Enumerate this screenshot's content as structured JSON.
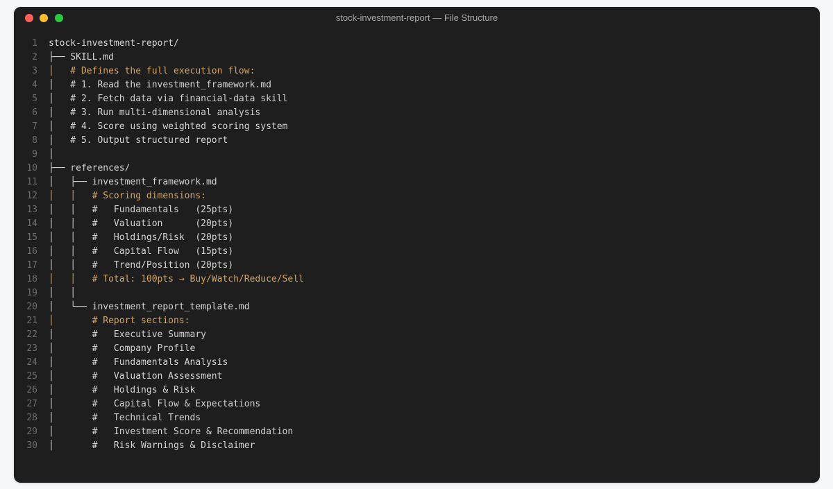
{
  "window": {
    "title": "stock-investment-report — File Structure"
  },
  "lines": [
    {
      "n": "1",
      "text": "stock-investment-report/",
      "hl": false
    },
    {
      "n": "2",
      "text": "├── SKILL.md",
      "hl": false
    },
    {
      "n": "3",
      "text": "│   # Defines the full execution flow:",
      "hl": true
    },
    {
      "n": "4",
      "text": "│   # 1. Read the investment_framework.md",
      "hl": false
    },
    {
      "n": "5",
      "text": "│   # 2. Fetch data via financial-data skill",
      "hl": false
    },
    {
      "n": "6",
      "text": "│   # 3. Run multi-dimensional analysis",
      "hl": false
    },
    {
      "n": "7",
      "text": "│   # 4. Score using weighted scoring system",
      "hl": false
    },
    {
      "n": "8",
      "text": "│   # 5. Output structured report",
      "hl": false
    },
    {
      "n": "9",
      "text": "│",
      "hl": false
    },
    {
      "n": "10",
      "text": "├── references/",
      "hl": false
    },
    {
      "n": "11",
      "text": "│   ├── investment_framework.md",
      "hl": false
    },
    {
      "n": "12",
      "text": "│   │   # Scoring dimensions:",
      "hl": true
    },
    {
      "n": "13",
      "text": "│   │   #   Fundamentals   (25pts)",
      "hl": false
    },
    {
      "n": "14",
      "text": "│   │   #   Valuation      (20pts)",
      "hl": false
    },
    {
      "n": "15",
      "text": "│   │   #   Holdings/Risk  (20pts)",
      "hl": false
    },
    {
      "n": "16",
      "text": "│   │   #   Capital Flow   (15pts)",
      "hl": false
    },
    {
      "n": "17",
      "text": "│   │   #   Trend/Position (20pts)",
      "hl": false
    },
    {
      "n": "18",
      "text": "│   │   # Total: 100pts → Buy/Watch/Reduce/Sell",
      "hl": true
    },
    {
      "n": "19",
      "text": "│   │",
      "hl": false
    },
    {
      "n": "20",
      "text": "│   └── investment_report_template.md",
      "hl": false
    },
    {
      "n": "21",
      "text": "│       # Report sections:",
      "hl": true
    },
    {
      "n": "22",
      "text": "│       #   Executive Summary",
      "hl": false
    },
    {
      "n": "23",
      "text": "│       #   Company Profile",
      "hl": false
    },
    {
      "n": "24",
      "text": "│       #   Fundamentals Analysis",
      "hl": false
    },
    {
      "n": "25",
      "text": "│       #   Valuation Assessment",
      "hl": false
    },
    {
      "n": "26",
      "text": "│       #   Holdings & Risk",
      "hl": false
    },
    {
      "n": "27",
      "text": "│       #   Capital Flow & Expectations",
      "hl": false
    },
    {
      "n": "28",
      "text": "│       #   Technical Trends",
      "hl": false
    },
    {
      "n": "29",
      "text": "│       #   Investment Score & Recommendation",
      "hl": false
    },
    {
      "n": "30",
      "text": "│       #   Risk Warnings & Disclaimer",
      "hl": false
    }
  ]
}
